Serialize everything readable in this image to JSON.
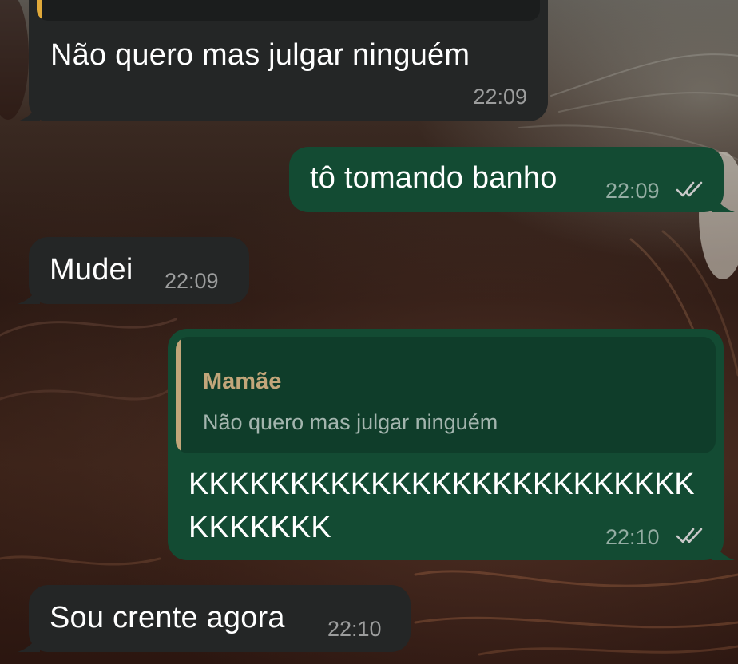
{
  "conversation": {
    "messages": [
      {
        "direction": "incoming",
        "text": "Não quero mas julgar ninguém",
        "time": "22:09"
      },
      {
        "direction": "outgoing",
        "text": "tô tomando banho",
        "time": "22:09",
        "status": "read"
      },
      {
        "direction": "incoming",
        "text": "Mudei",
        "time": "22:09"
      },
      {
        "direction": "outgoing",
        "reply_to": {
          "author": "Mamãe",
          "text": "Não quero mas julgar ninguém"
        },
        "text_line1": "KKKKKKKKKKKKKKKKKKKKKKKKK",
        "text_line2": "KKKKKKK",
        "time": "22:10",
        "status": "read"
      },
      {
        "direction": "incoming",
        "text": "Sou crente agora",
        "time": "22:10"
      }
    ]
  },
  "colors": {
    "incoming_bubble": "#242626",
    "outgoing_bubble": "#134b33",
    "quote_accent": "#c2a67a",
    "read_ticks": "#c9c9c9"
  },
  "icons": [
    "double-check-read-icon"
  ]
}
